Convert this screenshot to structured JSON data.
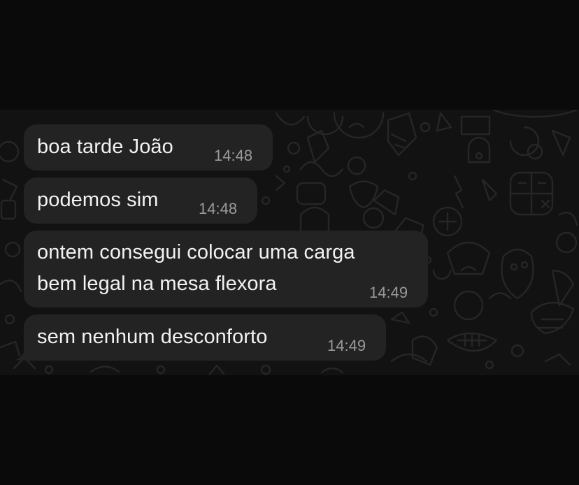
{
  "colors": {
    "screen_background": "#0a0a0a",
    "chat_background": "#121212",
    "incoming_bubble": "#232323",
    "message_text": "#f2f2f2",
    "timestamp_text": "#9a9a9a",
    "wallpaper_doodle": "#262626"
  },
  "messages": [
    {
      "direction": "incoming",
      "text": "boa tarde João",
      "time": "14:48"
    },
    {
      "direction": "incoming",
      "text": "podemos sim",
      "time": "14:48"
    },
    {
      "direction": "incoming",
      "text": "ontem consegui colocar uma carga\nbem legal na mesa flexora",
      "time": "14:49"
    },
    {
      "direction": "incoming",
      "text": "sem nenhum desconforto",
      "time": "14:49"
    }
  ]
}
